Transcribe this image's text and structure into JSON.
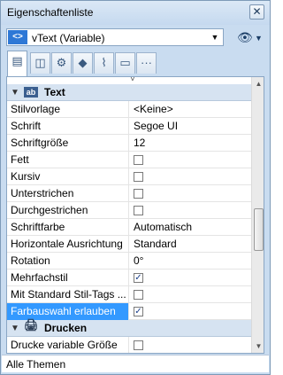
{
  "window": {
    "title": "Eigenschaftenliste",
    "close_glyph": "✕"
  },
  "object_selector": {
    "arrows_glyph": "<>",
    "value": "vText (Variable)",
    "dropdown_glyph": "▼"
  },
  "view_button": {
    "icon": "eye-icon",
    "glyph": "👁",
    "dropdown_glyph": "▼"
  },
  "tabs": [
    {
      "name": "properties",
      "glyph": "▤",
      "active": true
    },
    {
      "name": "layout",
      "glyph": "◫",
      "active": false
    },
    {
      "name": "settings",
      "glyph": "⚙",
      "active": false
    },
    {
      "name": "shapes",
      "glyph": "◆",
      "active": false
    },
    {
      "name": "chart",
      "glyph": "⌇",
      "active": false
    },
    {
      "name": "display",
      "glyph": "▭",
      "active": false
    },
    {
      "name": "more",
      "glyph": "···",
      "active": false
    }
  ],
  "groups": {
    "text": {
      "label": "Text",
      "toggle": "▼",
      "icon": "text-variable-icon",
      "icon_glyph": "ab"
    },
    "drucken": {
      "label": "Drucken",
      "toggle": "▼",
      "icon": "printer-icon",
      "icon_glyph": "🖨"
    }
  },
  "text_rows": [
    {
      "label": "Stilvorlage",
      "value": "<Keine>"
    },
    {
      "label": "Schrift",
      "value": "Segoe UI"
    },
    {
      "label": "Schriftgröße",
      "value": "12"
    },
    {
      "label": "Fett",
      "checkbox": false
    },
    {
      "label": "Kursiv",
      "checkbox": false
    },
    {
      "label": "Unterstrichen",
      "checkbox": false
    },
    {
      "label": "Durchgestrichen",
      "checkbox": false
    },
    {
      "label": "Schriftfarbe",
      "value": "Automatisch"
    },
    {
      "label": "Horizontale Ausrichtung",
      "value": "Standard"
    },
    {
      "label": "Rotation",
      "value": "0°"
    },
    {
      "label": "Mehrfachstil",
      "checkbox": true
    },
    {
      "label": "Mit Standard Stil-Tags ...",
      "checkbox": false
    },
    {
      "label": "Farbauswahl erlauben",
      "checkbox": true,
      "selected": true
    }
  ],
  "drucken_rows": [
    {
      "label": "Drucke variable Größe",
      "checkbox": false
    }
  ],
  "cut_off_glyph": "˅",
  "checkmark": "✓",
  "statusbar": {
    "text": "Alle Themen"
  }
}
